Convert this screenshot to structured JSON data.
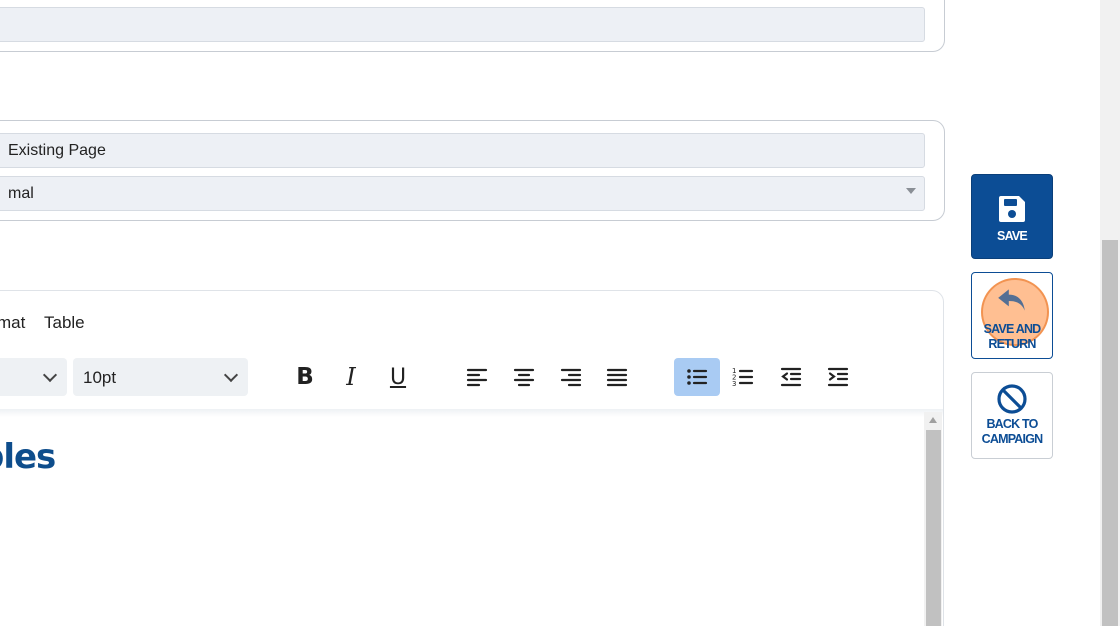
{
  "form": {
    "top_field_value": "",
    "page_field_value": "Existing Page",
    "style_select_value": "mal"
  },
  "editor": {
    "menu": [
      "mat",
      "Table"
    ],
    "font_family_value": "",
    "font_size_value": "10pt",
    "toolbar_icons": [
      "bold-icon",
      "italic-icon",
      "underline-icon",
      "align-left-icon",
      "align-center-icon",
      "align-right-icon",
      "align-justify-icon",
      "bullet-list-icon",
      "numbered-list-icon",
      "outdent-icon",
      "indent-icon"
    ],
    "content_heading": "bles"
  },
  "actions": {
    "save_label": "SAVE",
    "save_return_label": "SAVE AND\nRETURN",
    "back_label": "BACK TO\nCAMPAIGN"
  },
  "colors": {
    "primary": "#0c4d95",
    "heading": "#0e4d8c",
    "active_tool": "#a9cbf3",
    "highlight": "#ffaa6e"
  }
}
